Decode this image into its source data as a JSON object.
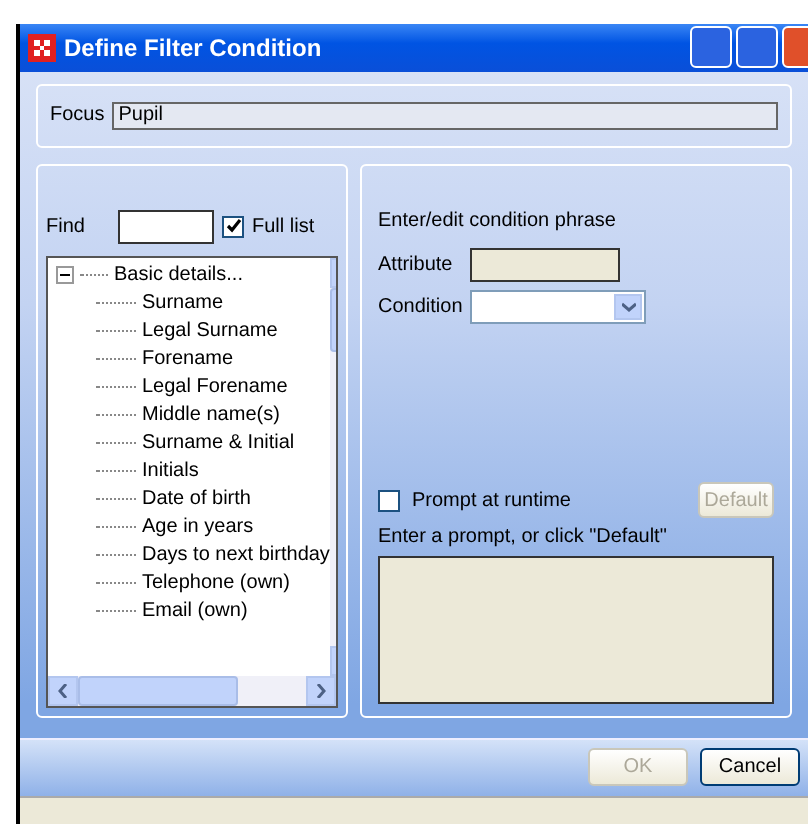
{
  "window": {
    "title": "Define Filter Condition"
  },
  "focus": {
    "label": "Focus",
    "value": "Pupil"
  },
  "find": {
    "label": "Find",
    "full_list": {
      "label": "Full list",
      "checked": true
    }
  },
  "tree": [
    {
      "label": "Basic details...",
      "expanded": true,
      "children": [
        {
          "label": "Surname"
        },
        {
          "label": "Legal Surname"
        },
        {
          "label": "Forename"
        },
        {
          "label": "Legal Forename"
        },
        {
          "label": "Middle name(s)"
        },
        {
          "label": "Surname & Initial"
        },
        {
          "label": "Initials"
        },
        {
          "label": "Date of birth"
        },
        {
          "label": "Age in years"
        },
        {
          "label": "Days to next birthday"
        },
        {
          "label": "Telephone (own)"
        },
        {
          "label": "Email (own)"
        }
      ]
    }
  ],
  "phrase": {
    "heading": "Enter/edit condition phrase",
    "attribute_label": "Attribute",
    "condition_label": "Condition"
  },
  "prompt": {
    "label": "Prompt at runtime",
    "checked": false,
    "hint": "Enter a prompt, or click \"Default\"",
    "default_button": {
      "label": "Default",
      "disabled": true
    }
  },
  "buttons": [
    {
      "label": "OK",
      "disabled": true
    },
    {
      "label": "Cancel",
      "disabled": false
    }
  ]
}
